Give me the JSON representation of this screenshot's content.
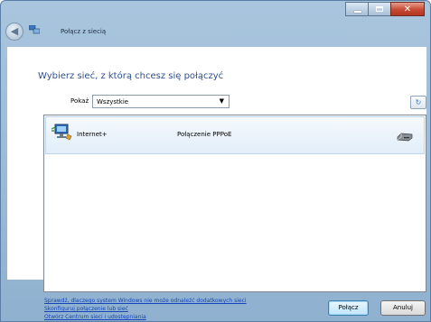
{
  "window": {
    "title": "Połącz z siecią",
    "controls": {
      "minimize": "minimize",
      "maximize": "maximize",
      "close": "close"
    }
  },
  "heading": "Wybierz sieć, z którą chcesz się połączyć",
  "filter": {
    "label": "Pokaż",
    "selected": "Wszystkie"
  },
  "networks": [
    {
      "name": "Internet+",
      "type": "Połączenie PPPoE",
      "icon": "dialup-network-icon",
      "status_icon": "modem-icon"
    }
  ],
  "links": [
    "Sprawdź, dlaczego system Windows nie może odnaleźć dodatkowych sieci",
    "Skonfiguruj połączenie lub sieć",
    "Otwórz Centrum sieci i udostępniania"
  ],
  "buttons": {
    "connect": "Połącz",
    "cancel": "Anuluj"
  },
  "colors": {
    "accent": "#2f4f92",
    "link": "#1544b8",
    "frame": "#a9c5de"
  }
}
